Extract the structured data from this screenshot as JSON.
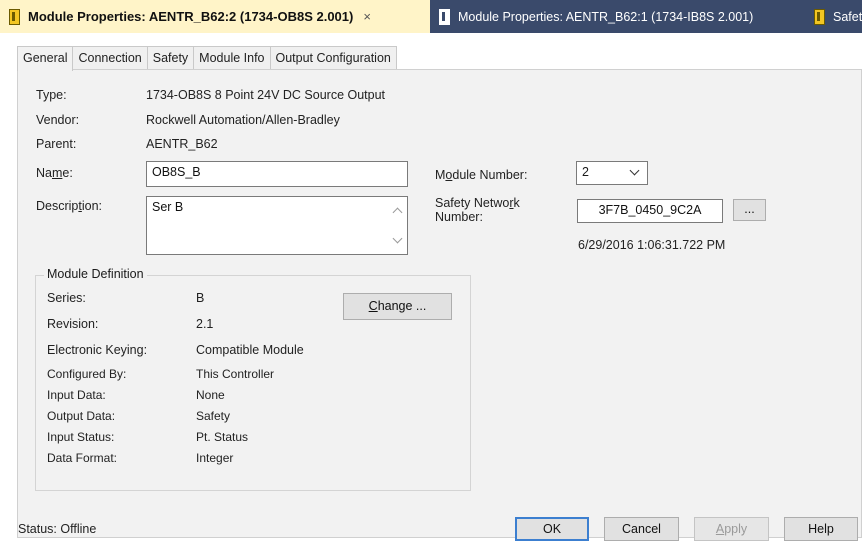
{
  "tabs_bar": {
    "active_title": "Module Properties: AENTR_B62:2 (1734-OB8S 2.001)",
    "close_glyph": "×",
    "second_title": "Module Properties: AENTR_B62:1 (1734-IB8S 2.001)",
    "third_title": "Safet",
    "icons": [
      "module-icon-yellow",
      "module-icon-dark",
      "module-icon-yellow"
    ]
  },
  "dialog_tabs": [
    "General",
    "Connection",
    "Safety",
    "Module Info",
    "Output Configuration"
  ],
  "general": {
    "type_label": "Type:",
    "type_value": "1734-OB8S 8 Point 24V DC Source Output",
    "vendor_label": "Vendor:",
    "vendor_value": "Rockwell Automation/Allen-Bradley",
    "parent_label": "Parent:",
    "parent_value": "AENTR_B62",
    "name_label_a": "Na",
    "name_label_u": "m",
    "name_label_b": "e:",
    "name_value": "OB8S_B",
    "description_label_a": "Descrip",
    "description_label_u": "t",
    "description_label_b": "ion:",
    "description_value": "Ser B",
    "module_number_label_a": "M",
    "module_number_label_u": "o",
    "module_number_label_b": "dule Number:",
    "module_number_value": "2",
    "safety_network_label_line1": "Safety Netwo",
    "safety_network_label_u": "r",
    "safety_network_label_line1b": "k",
    "safety_network_label_line2": "Number:",
    "safety_network_value": "3F7B_0450_9C2A",
    "browse_label": "...",
    "timestamp": "6/29/2016 1:06:31.722 PM"
  },
  "module_definition": {
    "title": "Module Definition",
    "change_button_u": "C",
    "change_button_rest": "hange ...",
    "rows": [
      {
        "label": "Series:",
        "value": "B"
      },
      {
        "label": "Revision:",
        "value": "2.1"
      },
      {
        "label": "Electronic Keying:",
        "value": "Compatible Module"
      },
      {
        "label": "Configured By:",
        "value": "This Controller"
      },
      {
        "label": "Input Data:",
        "value": "None"
      },
      {
        "label": "Output Data:",
        "value": "Safety"
      },
      {
        "label": "Input Status:",
        "value": "Pt. Status"
      },
      {
        "label": "Data Format:",
        "value": "Integer"
      }
    ]
  },
  "footer": {
    "status_text": "Status:  Offline",
    "ok_label": "OK",
    "cancel_label": "Cancel",
    "apply_label_u": "A",
    "apply_label_rest": "pply",
    "help_label": "Help"
  },
  "colors": {
    "tabstrip_bg": "#3a4a6b",
    "active_tab_bg": "#fff4c8",
    "default_button_border": "#3c7fd0"
  }
}
